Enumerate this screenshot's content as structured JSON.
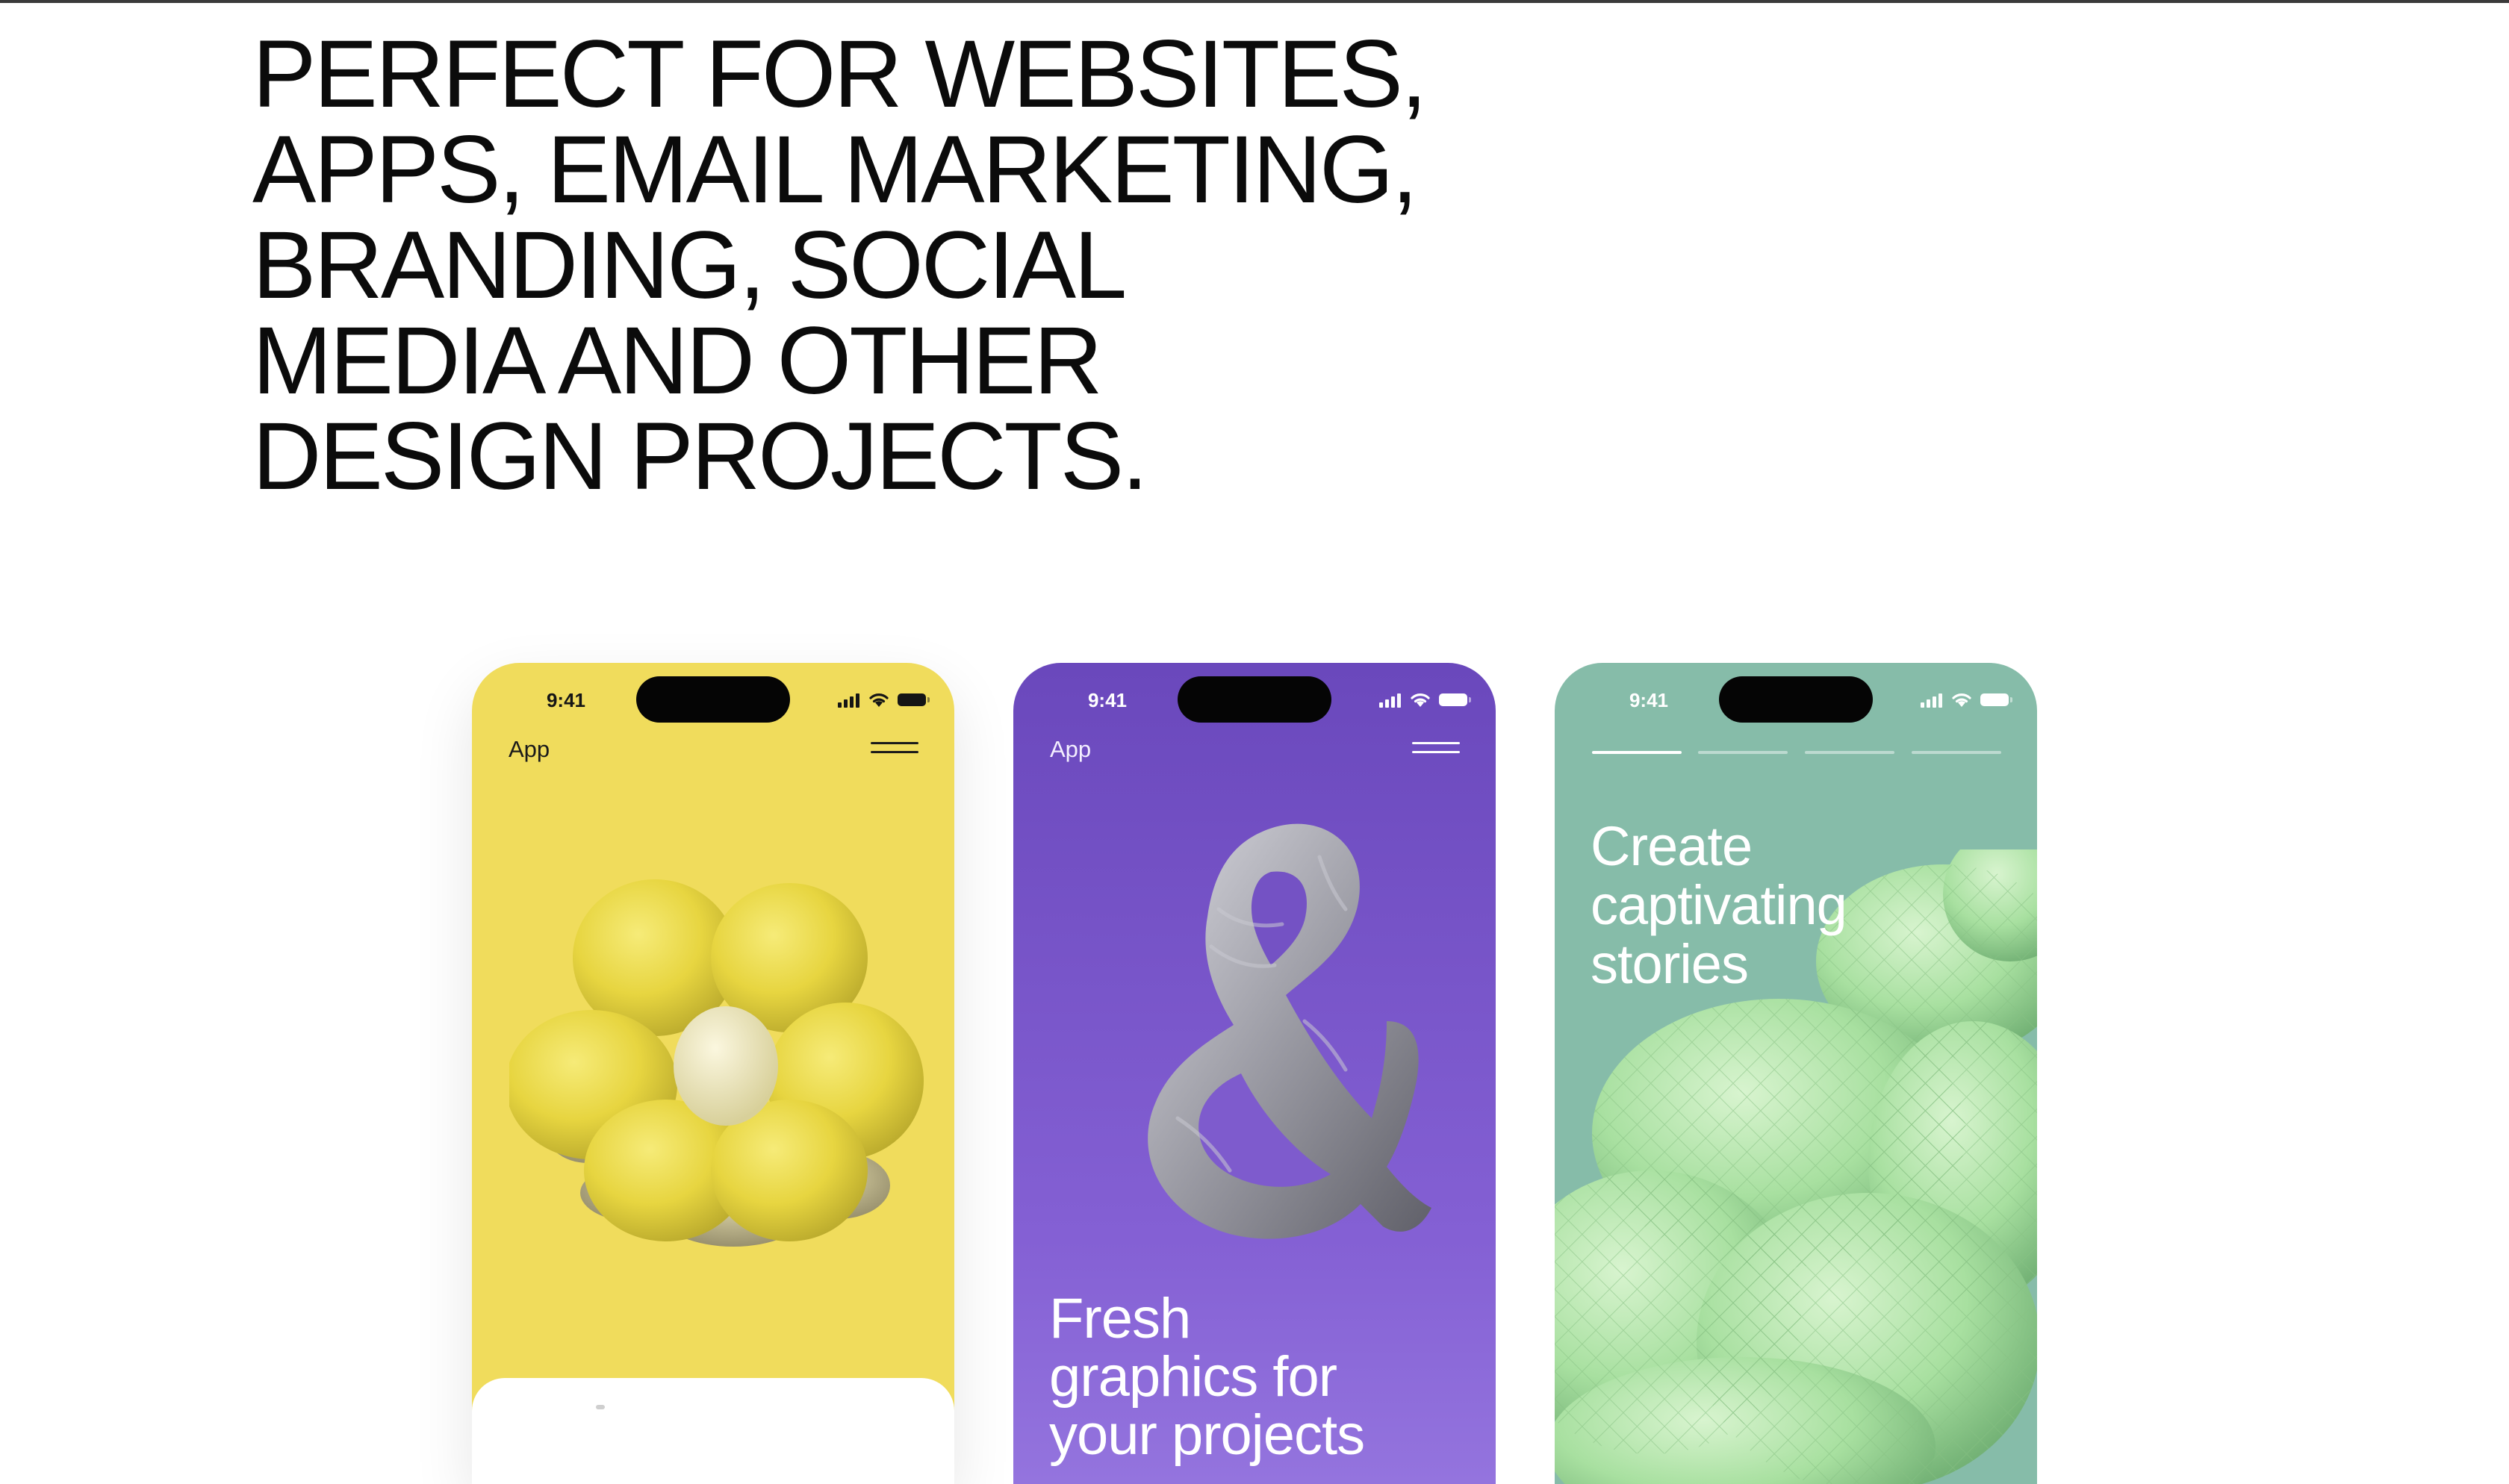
{
  "headline": {
    "lines": [
      "PERFECT FOR WEBSITES,",
      "APPS, EMAIL MARKETING,",
      "BRANDING, SOCIAL",
      "MEDIA AND OTHER",
      "DESIGN PROJECTS."
    ]
  },
  "phones": [
    {
      "theme": "yellow",
      "background": "#f0dc5c",
      "status_time": "9:41",
      "app_label": "App",
      "art": "inflated-flower"
    },
    {
      "theme": "purple",
      "background": "#6a48bc",
      "status_time": "9:41",
      "app_label": "App",
      "art": "inflated-ampersand",
      "headline_lines": [
        "Fresh",
        "graphics for",
        "your projects"
      ]
    },
    {
      "theme": "green",
      "background": "#86bca9",
      "status_time": "9:41",
      "art": "inflated-knot",
      "headline_lines": [
        "Create",
        "captivating",
        "stories"
      ],
      "story_segments": 4,
      "active_segment": 1
    }
  ],
  "icons": {
    "signal": "cellular-signal-icon",
    "wifi": "wifi-icon",
    "battery": "battery-icon",
    "menu": "hamburger-menu-icon"
  }
}
